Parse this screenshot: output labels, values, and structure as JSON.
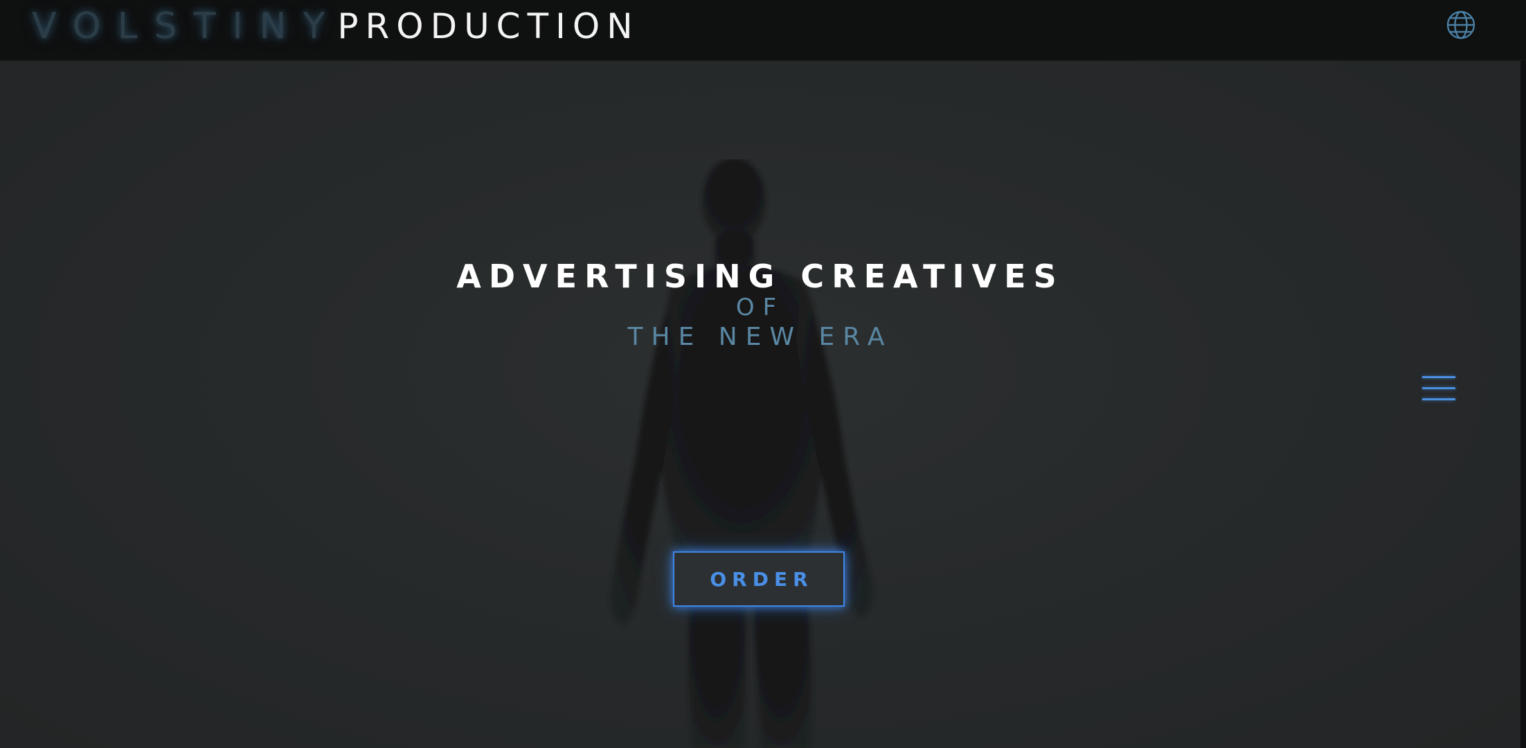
{
  "header": {
    "logo_part1": "VOLSTINY",
    "logo_part2": "PRODUCTION",
    "language_icon": "globe-icon"
  },
  "hero": {
    "headline": "ADVERTISING CREATIVES",
    "subline1": "OF",
    "subline2": "THE NEW ERA",
    "order_label": "ORDER",
    "menu_icon": "hamburger-menu-icon"
  },
  "colors": {
    "accent": "#4a90e2",
    "subtitle": "#5a87a3",
    "header_bg": "#0f1010",
    "hero_bg": "#262829"
  }
}
